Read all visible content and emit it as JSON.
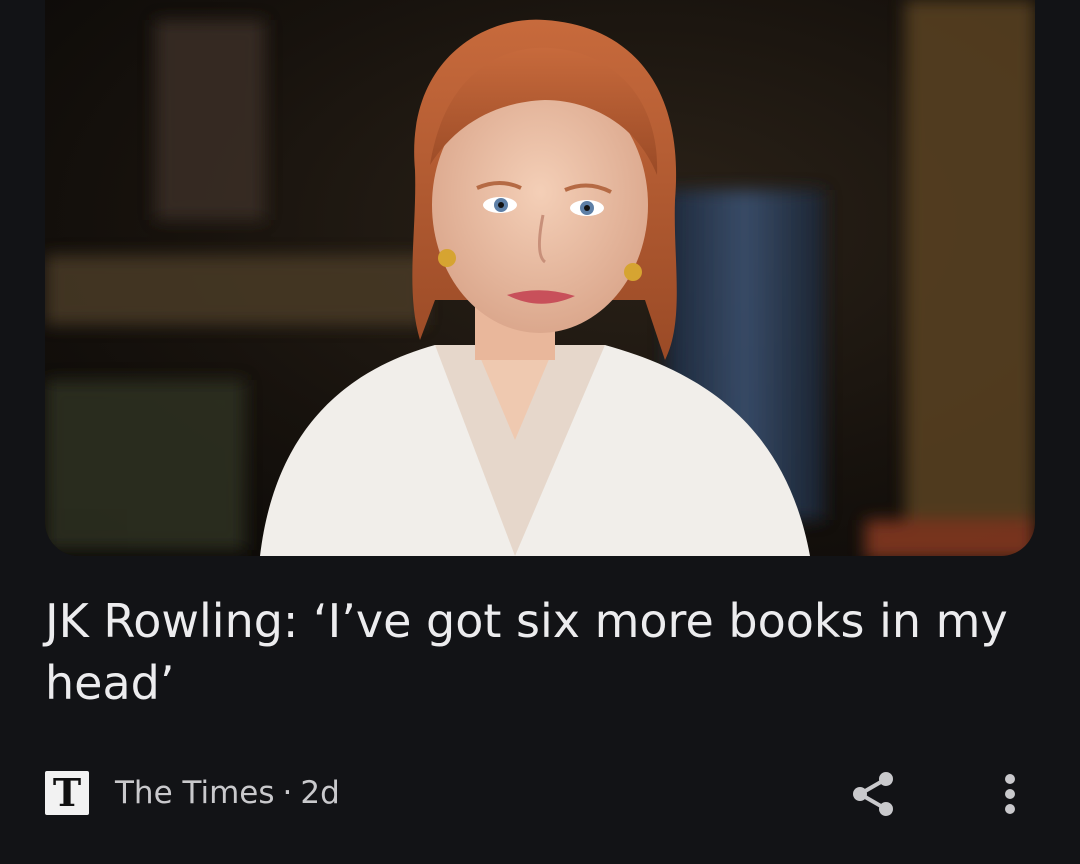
{
  "article": {
    "headline": "JK Rowling: ‘I’ve got six more books in my head’",
    "source_logo_letter": "T",
    "source_name": "The Times",
    "separator": "·",
    "age": "2d"
  },
  "icons": {
    "share": "share-icon",
    "more": "more-vert-icon"
  },
  "colors": {
    "background": "#121316",
    "text": "#ececee",
    "meta_text": "#c9c9cc"
  }
}
